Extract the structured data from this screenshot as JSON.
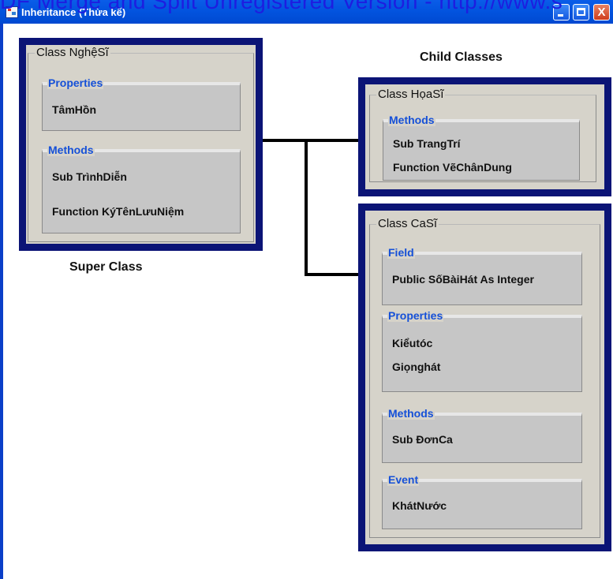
{
  "watermark": "DF  Merge and Split Unregistered Version - http://www.s",
  "window": {
    "title": "Inheritance (Thừa kế)",
    "close_glyph": "X"
  },
  "labels": {
    "super_class": "Super Class",
    "child_classes": "Child Classes"
  },
  "classes": {
    "nghesi": {
      "title": "Class NghệSĩ",
      "groups": [
        {
          "label": "Properties",
          "items": [
            "TâmHồn"
          ]
        },
        {
          "label": "Methods",
          "items": [
            "Sub  TrìnhDiễn",
            "Function  KýTênLưuNiệm"
          ]
        }
      ]
    },
    "hoasi": {
      "title": "Class HọaSĩ",
      "groups": [
        {
          "label": "Methods",
          "items": [
            "Sub  TrangTrí",
            "Function  VẽChânDung"
          ]
        }
      ]
    },
    "casi": {
      "title": "Class CaSĩ",
      "groups": [
        {
          "label": "Field",
          "items": [
            "Public  SốBàiHát As Integer"
          ]
        },
        {
          "label": "Properties",
          "items": [
            "Kiểutóc",
            "Giọnghát"
          ]
        },
        {
          "label": "Methods",
          "items": [
            "Sub  ĐơnCa"
          ]
        },
        {
          "label": "Event",
          "items": [
            "KhátNước"
          ]
        }
      ]
    }
  },
  "colors": {
    "titlebar": "#0355e0",
    "class_border": "#0b1476",
    "panel_bg": "#d6d3ca",
    "group_label": "#1550d8",
    "watermark": "#1d1ee0"
  }
}
